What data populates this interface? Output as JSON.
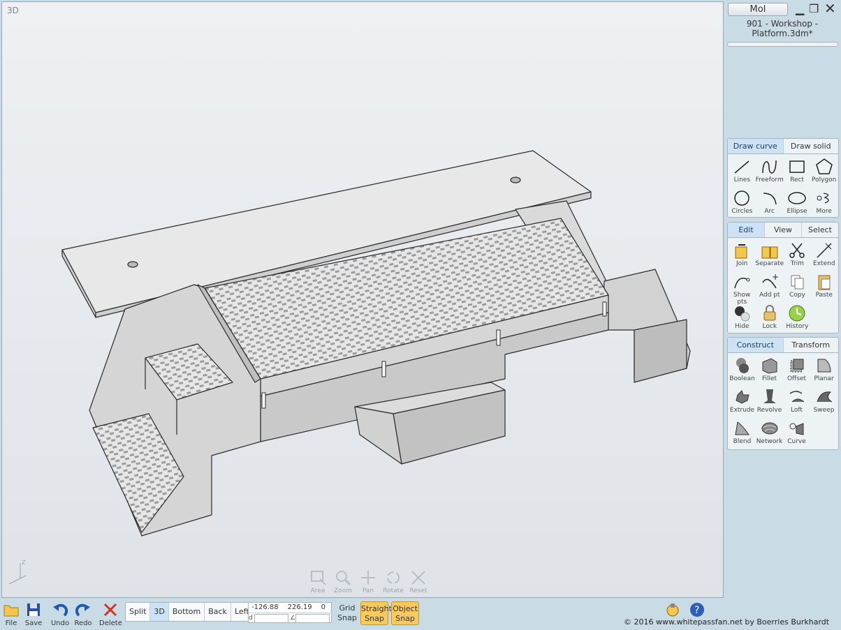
{
  "viewport": {
    "label": "3D",
    "axis_label": "Z",
    "nav_tools": [
      {
        "label": "Area",
        "icon": "area-zoom-icon"
      },
      {
        "label": "Zoom",
        "icon": "magnifier-icon"
      },
      {
        "label": "Pan",
        "icon": "pan-arrows-icon"
      },
      {
        "label": "Rotate",
        "icon": "rotate-icon"
      },
      {
        "label": "Reset",
        "icon": "reset-view-icon"
      }
    ]
  },
  "app": {
    "name": "MoI",
    "file_name": "901 - Workshop - Platform.3dm*"
  },
  "draw_panel": {
    "tabs": [
      "Draw curve",
      "Draw solid"
    ],
    "active_tab": "Draw curve",
    "tools": [
      {
        "label": "Lines",
        "icon": "line-icon"
      },
      {
        "label": "Freeform",
        "icon": "freeform-icon"
      },
      {
        "label": "Rect",
        "icon": "rectangle-icon"
      },
      {
        "label": "Polygon",
        "icon": "polygon-icon"
      },
      {
        "label": "Circles",
        "icon": "circle-icon"
      },
      {
        "label": "Arc",
        "icon": "arc-icon"
      },
      {
        "label": "Ellipse",
        "icon": "ellipse-icon"
      },
      {
        "label": "More",
        "icon": "more-curves-icon"
      }
    ]
  },
  "edit_panel": {
    "tabs": [
      "Edit",
      "View",
      "Select"
    ],
    "active_tab": "Edit",
    "tools": [
      {
        "label": "Join",
        "icon": "join-icon"
      },
      {
        "label": "Separate",
        "icon": "separate-icon"
      },
      {
        "label": "Trim",
        "icon": "scissors-icon"
      },
      {
        "label": "Extend",
        "icon": "extend-icon"
      },
      {
        "label": "Show pts",
        "icon": "show-points-icon"
      },
      {
        "label": "Add pt",
        "icon": "add-point-icon"
      },
      {
        "label": "Copy",
        "icon": "copy-icon"
      },
      {
        "label": "Paste",
        "icon": "paste-icon"
      },
      {
        "label": "Hide",
        "icon": "hide-icon"
      },
      {
        "label": "Lock",
        "icon": "lock-icon"
      },
      {
        "label": "History",
        "icon": "history-icon"
      }
    ]
  },
  "construct_panel": {
    "tabs": [
      "Construct",
      "Transform"
    ],
    "active_tab": "Construct",
    "tools": [
      {
        "label": "Boolean",
        "icon": "boolean-icon"
      },
      {
        "label": "Fillet",
        "icon": "fillet-icon"
      },
      {
        "label": "Offset",
        "icon": "offset-icon"
      },
      {
        "label": "Planar",
        "icon": "planar-icon"
      },
      {
        "label": "Extrude",
        "icon": "extrude-icon"
      },
      {
        "label": "Revolve",
        "icon": "revolve-icon"
      },
      {
        "label": "Loft",
        "icon": "loft-icon"
      },
      {
        "label": "Sweep",
        "icon": "sweep-icon"
      },
      {
        "label": "Blend",
        "icon": "blend-icon"
      },
      {
        "label": "Network",
        "icon": "network-icon"
      },
      {
        "label": "Curve",
        "icon": "curve-icon"
      }
    ]
  },
  "bottom_bar": {
    "buttons": [
      {
        "label": "File",
        "icon": "folder-icon"
      },
      {
        "label": "Save",
        "icon": "floppy-icon"
      },
      {
        "label": "Undo",
        "icon": "undo-icon"
      },
      {
        "label": "Redo",
        "icon": "redo-icon"
      },
      {
        "label": "Delete",
        "icon": "delete-x-icon"
      }
    ],
    "views": [
      "Split",
      "3D",
      "Bottom",
      "Back",
      "Left"
    ],
    "active_view": "3D",
    "coords": {
      "x": "-126.88",
      "y": "226.19",
      "z": "0"
    },
    "distance_label": "d",
    "angle_label": "∠",
    "grid_snap": "Grid Snap",
    "straight_snap": "Straight Snap",
    "object_snap": "Object Snap",
    "copyright": "© 2016 www.whitepassfan.net by Boerries Burkhardt"
  },
  "colors": {
    "active_tab": "#cde3f5",
    "snap_on": "#f8c95d",
    "panel_bg": "#c9dce6"
  }
}
